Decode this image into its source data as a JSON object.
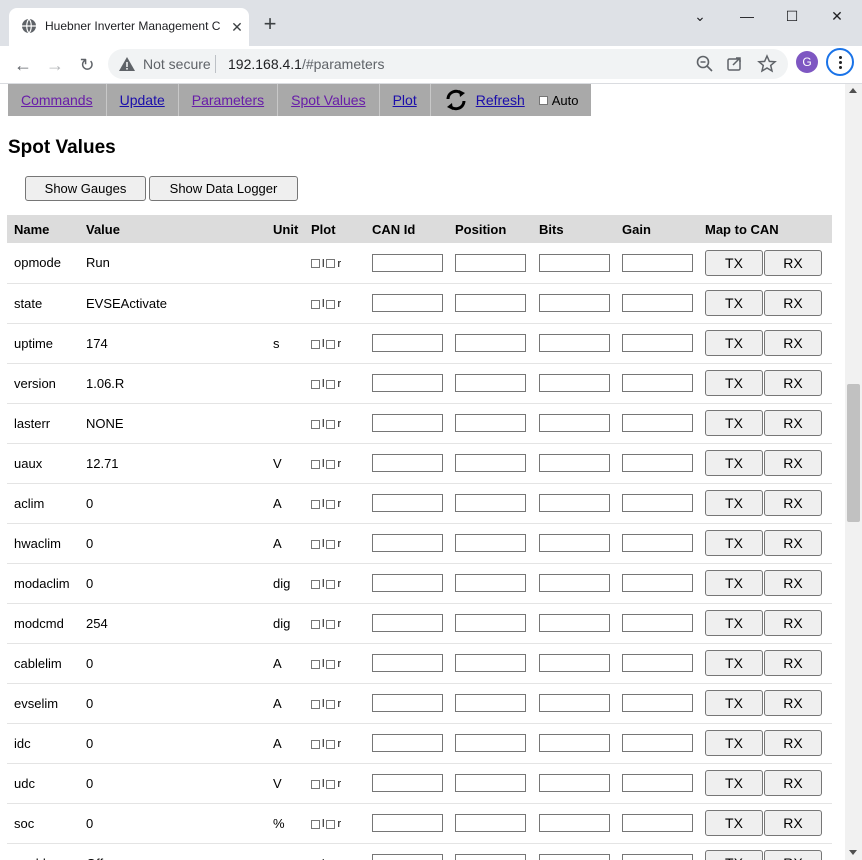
{
  "browser": {
    "tab_title": "Huebner Inverter Management C",
    "security_label": "Not secure",
    "url_host": "192.168.4.1",
    "url_path": "/#parameters",
    "avatar_letter": "G"
  },
  "menu": {
    "commands": "Commands",
    "update": "Update",
    "parameters": "Parameters",
    "spot_values": "Spot Values",
    "plot": "Plot",
    "refresh": "Refresh",
    "auto": "Auto"
  },
  "page": {
    "title": "Spot Values",
    "show_gauges": "Show Gauges",
    "show_data_logger": "Show Data Logger"
  },
  "table": {
    "headers": [
      "Name",
      "Value",
      "Unit",
      "Plot",
      "CAN Id",
      "Position",
      "Bits",
      "Gain",
      "Map to CAN"
    ],
    "plot_labels": [
      "l",
      "r"
    ],
    "tx_label": "TX",
    "rx_label": "RX",
    "rows": [
      {
        "name": "opmode",
        "value": "Run",
        "unit": ""
      },
      {
        "name": "state",
        "value": "EVSEActivate",
        "unit": ""
      },
      {
        "name": "uptime",
        "value": "174",
        "unit": "s"
      },
      {
        "name": "version",
        "value": "1.06.R",
        "unit": ""
      },
      {
        "name": "lasterr",
        "value": "NONE",
        "unit": ""
      },
      {
        "name": "uaux",
        "value": "12.71",
        "unit": "V"
      },
      {
        "name": "aclim",
        "value": "0",
        "unit": "A"
      },
      {
        "name": "hwaclim",
        "value": "0",
        "unit": "A"
      },
      {
        "name": "modaclim",
        "value": "0",
        "unit": "dig"
      },
      {
        "name": "modcmd",
        "value": "254",
        "unit": "dig"
      },
      {
        "name": "cablelim",
        "value": "0",
        "unit": "A"
      },
      {
        "name": "evselim",
        "value": "0",
        "unit": "A"
      },
      {
        "name": "idc",
        "value": "0",
        "unit": "A"
      },
      {
        "name": "udc",
        "value": "0",
        "unit": "V"
      },
      {
        "name": "soc",
        "value": "0",
        "unit": "%"
      },
      {
        "name": "enable",
        "value": "Off",
        "unit": ""
      }
    ]
  }
}
